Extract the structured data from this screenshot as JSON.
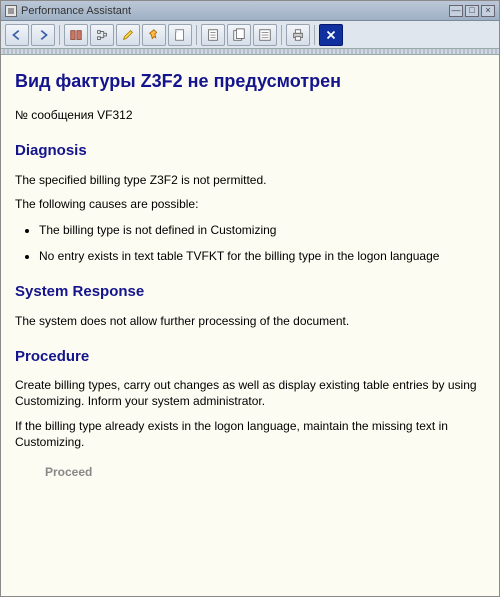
{
  "window": {
    "title": "Performance Assistant"
  },
  "toolbar": {
    "back": "Back",
    "forward": "Forward",
    "book": "Application Help",
    "tree": "Technical Information",
    "edit": "Edit",
    "pin": "Customizing",
    "note": "Note",
    "doc": "Document",
    "docs": "Documents",
    "list": "List",
    "print": "Print",
    "close": "Close"
  },
  "content": {
    "heading": "Вид фактуры Z3F2 не предусмотрен",
    "message_no": "№ сообщения VF312",
    "diagnosis_h": "Diagnosis",
    "diag_p1": "The specified billing type Z3F2 is not permitted.",
    "diag_p2": "The following causes are possible:",
    "diag_li1": "The billing type is not defined in Customizing",
    "diag_li2": "No entry exists in text table TVFKT for the billing type in the logon language",
    "sysresp_h": "System Response",
    "sysresp_p": "The system does not allow further processing of the document.",
    "proc_h": "Procedure",
    "proc_p1": "Create billing types, carry out changes as well as display existing table entries by using Customizing. Inform your system administrator.",
    "proc_p2": "If the billing type already exists in the logon language, maintain the missing text in Customizing.",
    "proceed": "Proceed"
  }
}
